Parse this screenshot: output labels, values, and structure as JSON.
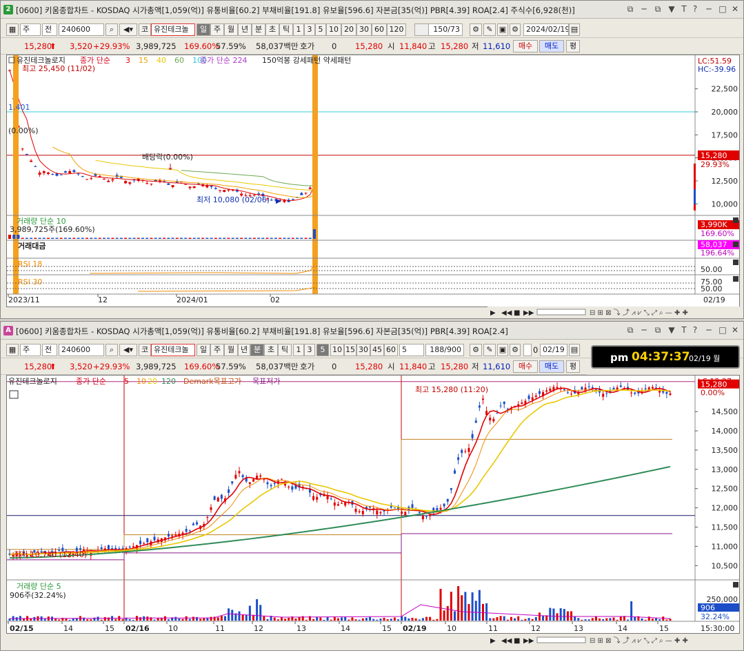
{
  "top": {
    "badge": "2",
    "title": "[0600] 키움종합차트 - KOSDAQ 시가총액[1,059(억)] 유통비율[60.2] 부채비율[191.8] 유보율[596.6] 자본금[35(억)] PBR[4.39] ROA[2.4] 주식수[6,928(천)]",
    "toolbar": {
      "mode1": "주",
      "mode2": "전",
      "code": "240600",
      "codeicon": "코",
      "name": "유진테크놀",
      "periods": [
        "일",
        "주",
        "월",
        "년",
        "분",
        "초",
        "틱"
      ],
      "nums": [
        "1",
        "3",
        "5",
        "10",
        "20",
        "30",
        "60",
        "120"
      ],
      "count": "150/73",
      "date": "2024/02/19"
    },
    "quote": {
      "price": "15,280",
      "change": "3,520",
      "rate": "+29.93%",
      "volume": "3,989,725",
      "vol_rate": "169.60%",
      "turnover": "57.59%",
      "amount": "58,037백만",
      "hoga_label": "호가",
      "hoga_value": "0",
      "open_label": "시",
      "open": "11,840",
      "cur": "15,280",
      "high_label": "고",
      "high": "15,280",
      "low_label": "저",
      "low": "11,610",
      "buy": "매수",
      "sell": "매도",
      "avg": "평"
    },
    "legend": {
      "name": "유진테크놀로지",
      "ma_label": "종가 단순",
      "ma": [
        "3",
        "15",
        "40",
        "60",
        "100"
      ],
      "ma2_label": "종가 단순 224",
      "extra": "150억봉 강세패턴  약세패턴"
    },
    "annotations": {
      "high": "최고 25,450 (11/02)",
      "low": "최저 10,080 (02/06)",
      "dividend": "배당락(0.00%)",
      "left_val": "1.401",
      "left_pct": "(0.00%)"
    },
    "axis": {
      "y": [
        "22,500",
        "20,000",
        "17,500",
        "15,000",
        "12,500",
        "10,000"
      ],
      "x": [
        "2023/11",
        "12",
        "2024/01",
        "02"
      ],
      "x_end": "02/19"
    },
    "right": {
      "lc": "LC:51.59",
      "hc": "HC:-39.96",
      "price_tag": "15,280",
      "price_pct": "29.93%",
      "vol_tag": "3,990K",
      "vol_pct": "169.60%",
      "amt_tag": "58,037",
      "amt_pct": "196.64%",
      "rsi1": "50.00",
      "rsi2a": "75.00",
      "rsi2b": "50.00"
    },
    "panes": {
      "volume": "거래량 단순 10",
      "volume_val": "3,989,725주(169.60%)",
      "amount": "거래대금",
      "rsi1": "RSI 18",
      "rsi2": "RSI 30"
    }
  },
  "bottom": {
    "badge": "A",
    "title": "[0600] 키움종합차트 - KOSDAQ 시가총액[1,059(억)] 유통비율[60.2] 부채비율[191.8] 유보율[596.6] 자본금[35(억)] PBR[4.39] ROA[2.4]",
    "toolbar": {
      "mode1": "주",
      "mode2": "전",
      "code": "240600",
      "codeicon": "코",
      "name": "유진테크놀",
      "periods": [
        "일",
        "주",
        "월",
        "년",
        "분",
        "초",
        "틱"
      ],
      "nums": [
        "1",
        "3",
        "5",
        "10",
        "15",
        "30",
        "45",
        "60"
      ],
      "sel_min": "5",
      "count": "188/900",
      "date": "02/19"
    },
    "quote": {
      "price": "15,280",
      "change": "3,520",
      "rate": "+29.93%",
      "volume": "3,989,725",
      "vol_rate": "169.60%",
      "turnover": "57.59%",
      "amount": "58,037백만",
      "hoga_label": "호가",
      "hoga_value": "0",
      "open_label": "시",
      "open": "11,840",
      "cur": "15,280",
      "high_label": "고",
      "high": "15,280",
      "low_label": "저",
      "low": "11,610",
      "buy": "매수",
      "sell": "매도",
      "avg": "평"
    },
    "clock": {
      "ampm": "pm",
      "time": "04:37:37",
      "date": "02/19 월"
    },
    "legend": {
      "name": "유진테크놀로지",
      "ma_label": "종가 단순",
      "ma": [
        "5",
        "10",
        "20",
        "120"
      ],
      "demark": "Demark목표고가",
      "demark2": "목표저가"
    },
    "annotations": {
      "high": "최고 15,280 (11:20)",
      "low": "최저 10,740 (12:40)"
    },
    "axis": {
      "y": [
        "14,500",
        "14,000",
        "13,500",
        "13,000",
        "12,500",
        "12,000",
        "11,500",
        "11,000",
        "10,500"
      ],
      "x": [
        "02/15",
        "14",
        "15",
        "02/16",
        "10",
        "11",
        "12",
        "13",
        "14",
        "15",
        "02/19",
        "10",
        "11",
        "12",
        "13",
        "14",
        "15"
      ],
      "x_end": "15:30:00",
      "vol_y": "250,000"
    },
    "right": {
      "lc": "LC:12.27",
      "price_tag": "15,280",
      "price_pct": "0.00%",
      "vol_tag": "906",
      "vol_pct": "32.24%"
    },
    "panes": {
      "volume": "거래량 단순 5",
      "volume_val": "906주(32.24%)"
    }
  },
  "chart_data": [
    {
      "type": "candlestick",
      "title": "유진테크놀로지 일봉",
      "x": [
        "2023/11",
        "12",
        "2024/01",
        "02",
        "02/19"
      ],
      "ylim": [
        8900,
        26000
      ],
      "key_points": [
        {
          "x": "11/02",
          "high": 25450
        },
        {
          "x": "02/06",
          "low": 10080
        },
        {
          "x": "02/19",
          "open": 11840,
          "high": 15280,
          "low": 11610,
          "close": 15280
        }
      ],
      "horizontal_lines": [
        20000,
        15280
      ]
    },
    {
      "type": "candlestick",
      "title": "유진테크놀로지 5분봉",
      "x": [
        "02/15",
        "02/16",
        "02/19"
      ],
      "ylim": [
        10200,
        15400
      ],
      "key_points": [
        {
          "x": "12:40",
          "low": 10740
        },
        {
          "x": "11:20",
          "high": 15280
        }
      ],
      "horizontal_lines": [
        11800
      ]
    }
  ]
}
